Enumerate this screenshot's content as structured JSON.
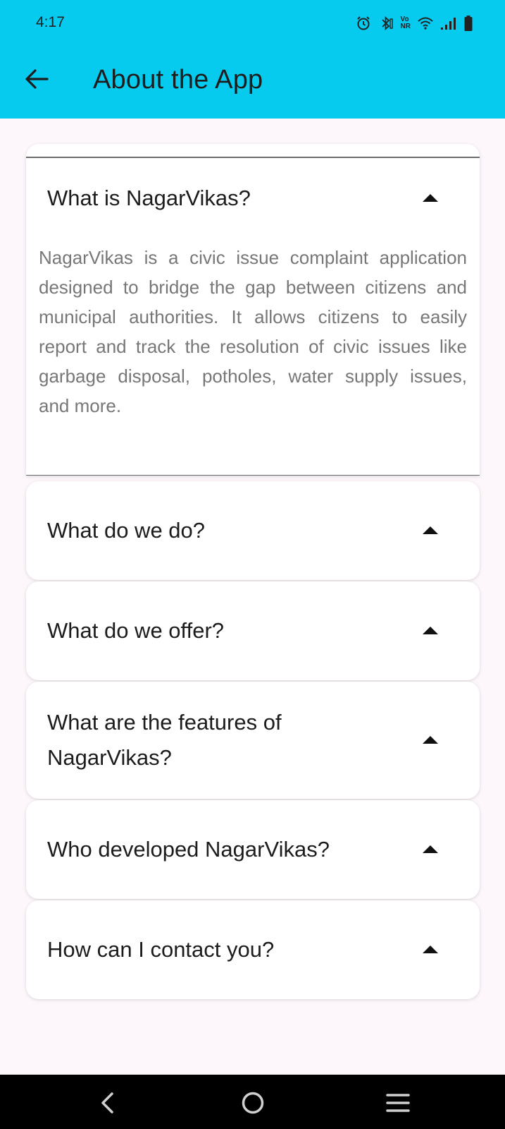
{
  "status_bar": {
    "time": "4:17",
    "icons": [
      "alarm-icon",
      "bluetooth-icon",
      "volte-icon",
      "wifi-icon",
      "signal-icon",
      "battery-icon"
    ],
    "volte_text_top": "Vo",
    "volte_text_bottom": "NR"
  },
  "app_bar": {
    "title": "About the App",
    "back_icon": "arrow-left-icon",
    "background": "#06cbef"
  },
  "faq": [
    {
      "question": "What is NagarVikas?",
      "expanded": true,
      "answer": "NagarVikas is a civic issue complaint application designed to bridge the gap between citizens and municipal authorities. It allows citizens to easily report and track the resolution of civic issues like garbage disposal, potholes, water supply issues, and more."
    },
    {
      "question": "What do we do?",
      "expanded": false
    },
    {
      "question": "What do we offer?",
      "expanded": false
    },
    {
      "question": "What are the features of NagarVikas?",
      "expanded": false
    },
    {
      "question": "Who developed NagarVikas?",
      "expanded": false
    },
    {
      "question": "How can I contact you?",
      "expanded": false
    }
  ],
  "nav_bar": {
    "buttons": [
      "nav-back-icon",
      "nav-home-icon",
      "nav-recents-icon"
    ]
  }
}
